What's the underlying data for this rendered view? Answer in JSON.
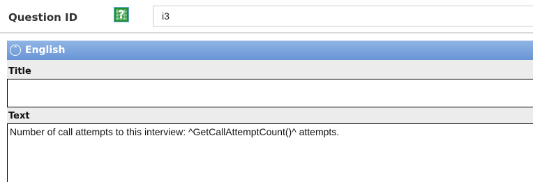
{
  "question_id": {
    "label": "Question ID",
    "help_icon_glyph": "?",
    "value": "i3"
  },
  "language_panel": {
    "title": "English",
    "collapse_icon_glyph": "⌃",
    "header_color": "#7aa3dc"
  },
  "fields": {
    "title": {
      "label": "Title",
      "value": ""
    },
    "text": {
      "label": "Text",
      "value": "Number of call attempts to this interview: ^GetCallAttemptCount()^ attempts."
    }
  }
}
